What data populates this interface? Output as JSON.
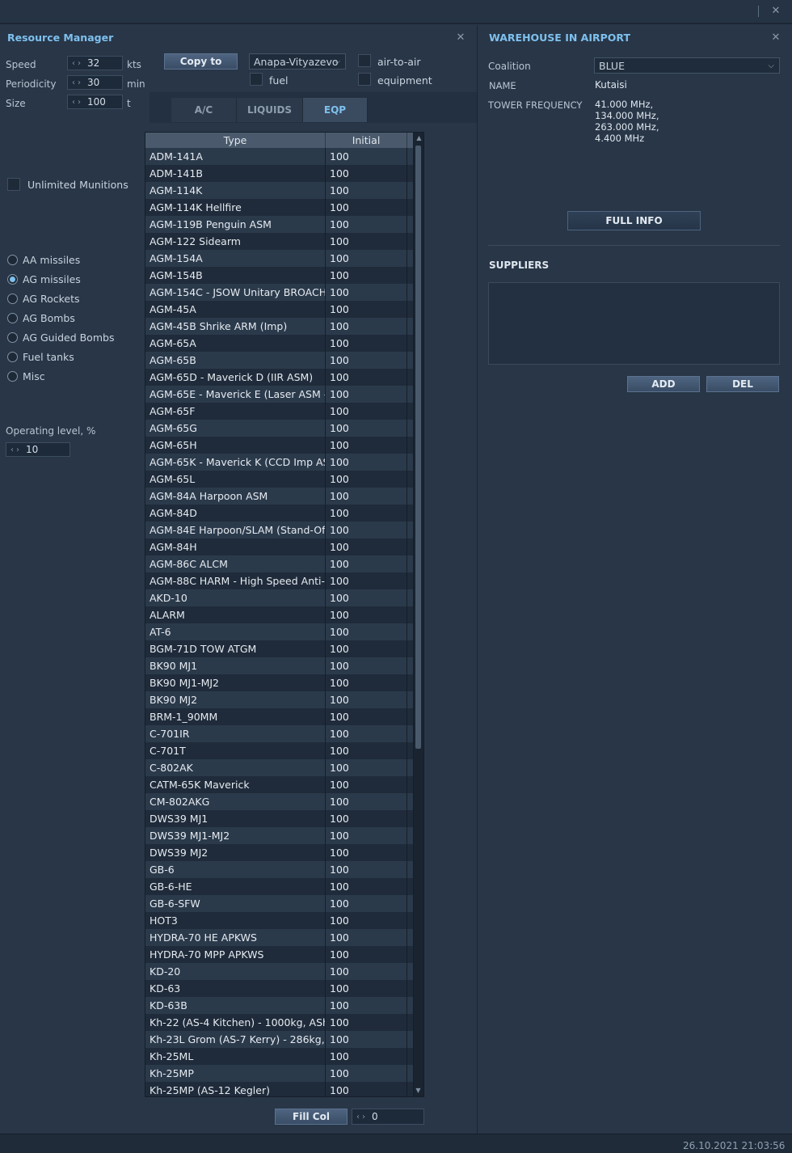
{
  "window": {
    "close_icon": "close-icon"
  },
  "resource_manager": {
    "title": "Resource Manager",
    "speed": {
      "label": "Speed",
      "value": "32",
      "unit": "kts"
    },
    "periodicity": {
      "label": "Periodicity",
      "value": "30",
      "unit": "min"
    },
    "size": {
      "label": "Size",
      "value": "100",
      "unit": "t"
    },
    "copy_to_label": "Copy to",
    "copy_target": "Anapa-Vityazevo",
    "fuel_label": "fuel",
    "air_to_air_label": "air-to-air",
    "equipment_label": "equipment",
    "tabs": [
      {
        "label": "A/C"
      },
      {
        "label": "LIQUIDS"
      },
      {
        "label": "EQP",
        "active": true
      }
    ],
    "unlimited_munitions_label": "Unlimited Munitions",
    "categories": [
      {
        "label": "AA missiles",
        "selected": false
      },
      {
        "label": "AG missiles",
        "selected": true
      },
      {
        "label": "AG Rockets",
        "selected": false
      },
      {
        "label": "AG Bombs",
        "selected": false
      },
      {
        "label": "AG Guided Bombs",
        "selected": false
      },
      {
        "label": "Fuel tanks",
        "selected": false
      },
      {
        "label": "Misc",
        "selected": false
      }
    ],
    "operating_level_label": "Operating level, %",
    "operating_level_value": "10",
    "table": {
      "headers": {
        "type": "Type",
        "initial": "Initial"
      },
      "rows": [
        [
          "ADM-141A",
          "100"
        ],
        [
          "ADM-141B",
          "100"
        ],
        [
          "AGM-114K",
          "100"
        ],
        [
          "AGM-114K Hellfire",
          "100"
        ],
        [
          "AGM-119B Penguin ASM",
          "100"
        ],
        [
          "AGM-122 Sidearm",
          "100"
        ],
        [
          "AGM-154A",
          "100"
        ],
        [
          "AGM-154B",
          "100"
        ],
        [
          "AGM-154C - JSOW Unitary BROACH",
          "100"
        ],
        [
          "AGM-45A",
          "100"
        ],
        [
          "AGM-45B Shrike ARM (Imp)",
          "100"
        ],
        [
          "AGM-65A",
          "100"
        ],
        [
          "AGM-65B",
          "100"
        ],
        [
          "AGM-65D - Maverick D (IIR ASM)",
          "100"
        ],
        [
          "AGM-65E - Maverick E (Laser ASM - L",
          "100"
        ],
        [
          "AGM-65F",
          "100"
        ],
        [
          "AGM-65G",
          "100"
        ],
        [
          "AGM-65H",
          "100"
        ],
        [
          "AGM-65K - Maverick K (CCD Imp ASM",
          "100"
        ],
        [
          "AGM-65L",
          "100"
        ],
        [
          "AGM-84A Harpoon ASM",
          "100"
        ],
        [
          "AGM-84D",
          "100"
        ],
        [
          "AGM-84E Harpoon/SLAM (Stand-Off L",
          "100"
        ],
        [
          "AGM-84H",
          "100"
        ],
        [
          "AGM-86C ALCM",
          "100"
        ],
        [
          "AGM-88C HARM - High Speed Anti-Ra",
          "100"
        ],
        [
          "AKD-10",
          "100"
        ],
        [
          "ALARM",
          "100"
        ],
        [
          "AT-6",
          "100"
        ],
        [
          "BGM-71D TOW ATGM",
          "100"
        ],
        [
          "BK90 MJ1",
          "100"
        ],
        [
          "BK90 MJ1-MJ2",
          "100"
        ],
        [
          "BK90 MJ2",
          "100"
        ],
        [
          "BRM-1_90MM",
          "100"
        ],
        [
          "C-701IR",
          "100"
        ],
        [
          "C-701T",
          "100"
        ],
        [
          "C-802AK",
          "100"
        ],
        [
          "CATM-65K Maverick",
          "100"
        ],
        [
          "CM-802AKG",
          "100"
        ],
        [
          "DWS39 MJ1",
          "100"
        ],
        [
          "DWS39 MJ1-MJ2",
          "100"
        ],
        [
          "DWS39 MJ2",
          "100"
        ],
        [
          "GB-6",
          "100"
        ],
        [
          "GB-6-HE",
          "100"
        ],
        [
          "GB-6-SFW",
          "100"
        ],
        [
          "HOT3",
          "100"
        ],
        [
          "HYDRA-70 HE APKWS",
          "100"
        ],
        [
          "HYDRA-70 MPP APKWS",
          "100"
        ],
        [
          "KD-20",
          "100"
        ],
        [
          "KD-63",
          "100"
        ],
        [
          "KD-63B",
          "100"
        ],
        [
          "Kh-22 (AS-4 Kitchen) - 1000kg, AShM,",
          "100"
        ],
        [
          "Kh-23L Grom (AS-7 Kerry) - 286kg, A",
          "100"
        ],
        [
          "Kh-25ML",
          "100"
        ],
        [
          "Kh-25MP",
          "100"
        ],
        [
          "Kh-25MP (AS-12 Kegler)",
          "100"
        ]
      ]
    },
    "fill_col_label": "Fill Col",
    "fill_col_value": "0"
  },
  "warehouse": {
    "title": "WAREHOUSE IN AIRPORT",
    "coalition_label": "Coalition",
    "coalition_value": "BLUE",
    "name_label": "NAME",
    "name_value": "Kutaisi",
    "tower_label": "TOWER FREQUENCY",
    "frequencies": [
      "41.000 MHz,",
      "134.000 MHz,",
      "263.000 MHz,",
      "4.400 MHz"
    ],
    "full_info_label": "FULL INFO",
    "suppliers_label": "SUPPLIERS",
    "add_label": "ADD",
    "del_label": "DEL"
  },
  "status": {
    "datetime": "26.10.2021 21:03:56"
  }
}
